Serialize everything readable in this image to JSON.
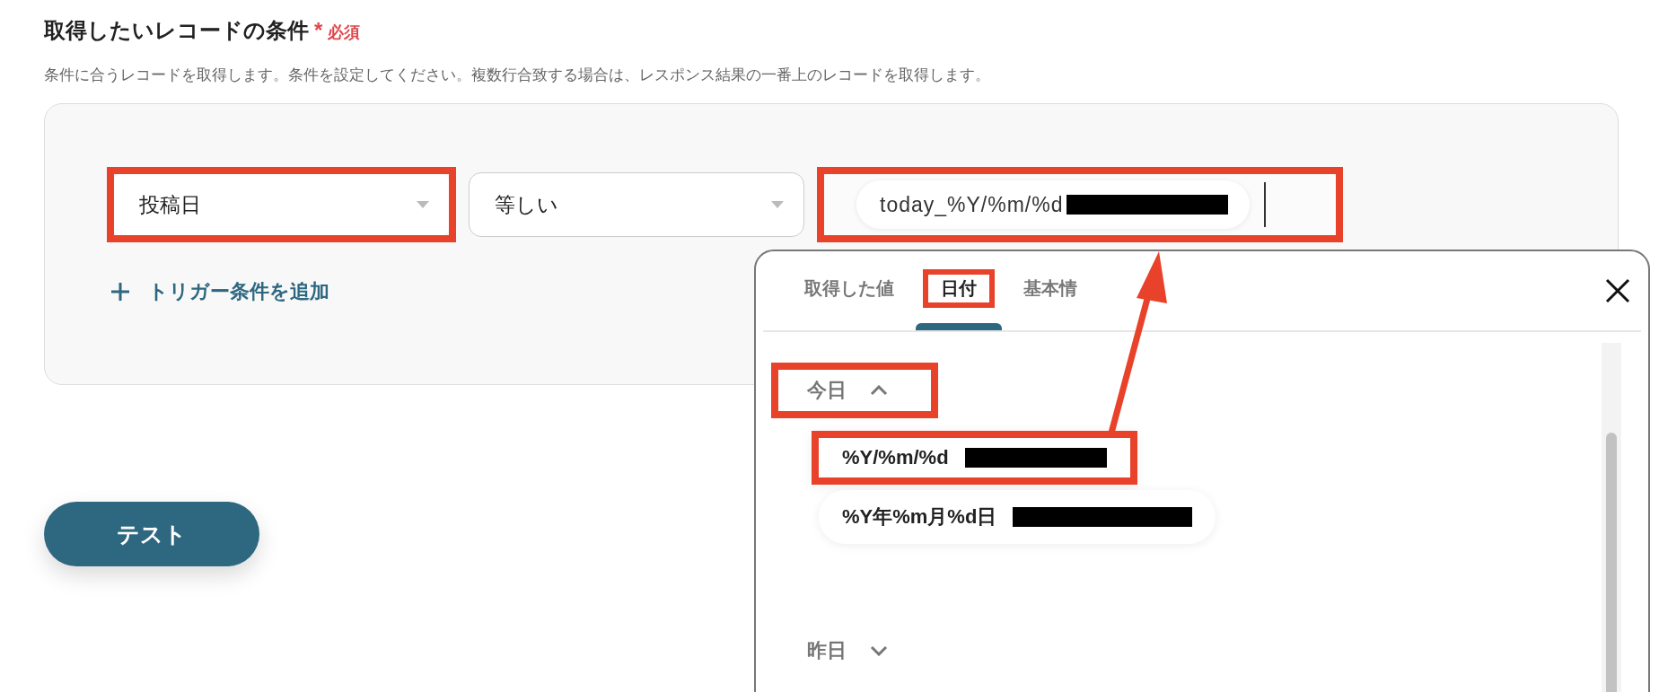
{
  "section": {
    "title": "取得したいレコードの条件",
    "required_mark": "*",
    "required_label": "必須",
    "description": "条件に合うレコードを取得します。条件を設定してください。複数行合致する場合は、レスポンス結果の一番上のレコードを取得します。"
  },
  "condition": {
    "field": {
      "value": "投稿日",
      "highlighted": true
    },
    "operator": {
      "value": "等しい",
      "highlighted": false
    },
    "value_field": {
      "value": "today_%Y/%m/%d",
      "highlighted": true
    }
  },
  "add_condition": {
    "label": "トリガー条件を追加"
  },
  "test_button": {
    "label": "テスト"
  },
  "picker": {
    "tabs": [
      {
        "label": "取得した値",
        "selected": false,
        "highlighted": false
      },
      {
        "label": "日付",
        "selected": true,
        "highlighted": true
      },
      {
        "label": "基本情",
        "selected": false,
        "highlighted": false
      }
    ],
    "groups": [
      {
        "label": "今日",
        "expanded": true,
        "highlighted": true,
        "items": [
          {
            "label": "%Y/%m/%d",
            "highlighted": true
          },
          {
            "label": "%Y年%m月%d日",
            "highlighted": false
          }
        ]
      },
      {
        "label": "昨日",
        "expanded": false,
        "highlighted": false
      }
    ]
  }
}
